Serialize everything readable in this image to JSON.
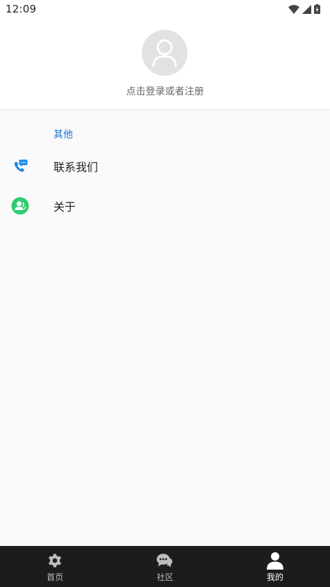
{
  "status_bar": {
    "time": "12:09"
  },
  "profile": {
    "login_prompt": "点击登录或者注册",
    "avatar_icon": "person-outline-icon"
  },
  "section": {
    "title": "其他"
  },
  "menu": [
    {
      "label": "联系我们",
      "icon": "phone-chat-icon",
      "color": "#1e88e5"
    },
    {
      "label": "关于",
      "icon": "person-circle-icon",
      "color": "#2ecc71"
    }
  ],
  "bottom_nav": {
    "tabs": [
      {
        "label": "首页",
        "icon": "gear-icon",
        "active": false
      },
      {
        "label": "社区",
        "icon": "chat-bubble-icon",
        "active": false
      },
      {
        "label": "我的",
        "icon": "person-icon",
        "active": true
      }
    ]
  },
  "colors": {
    "accent": "#1976d2",
    "nav_bg": "#1c1c1c",
    "background": "#fafafa"
  }
}
